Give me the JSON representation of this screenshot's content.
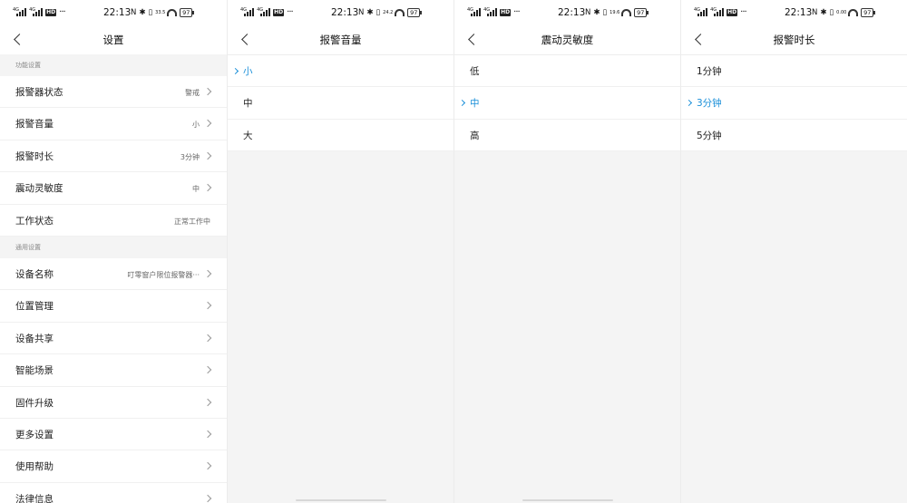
{
  "status": {
    "carrier_a": "4G",
    "carrier_b": "4G",
    "hd": "HD",
    "more": "···",
    "time": "22:13",
    "nfc": "N",
    "speeds": [
      "33.5",
      "24.2",
      "19.6",
      "0.00"
    ],
    "battery": "97"
  },
  "settings": {
    "title": "设置",
    "section_function": "功能设置",
    "function_items": [
      {
        "label": "报警器状态",
        "value": "警戒"
      },
      {
        "label": "报警音量",
        "value": "小"
      },
      {
        "label": "报警时长",
        "value": "3分钟"
      },
      {
        "label": "震动灵敏度",
        "value": "中"
      },
      {
        "label": "工作状态",
        "value": "正常工作中"
      }
    ],
    "section_general": "通用设置",
    "general_items": [
      {
        "label": "设备名称",
        "value": "叮零窗户限位报警器···"
      },
      {
        "label": "位置管理",
        "value": ""
      },
      {
        "label": "设备共享",
        "value": ""
      },
      {
        "label": "智能场景",
        "value": ""
      },
      {
        "label": "固件升级",
        "value": ""
      },
      {
        "label": "更多设置",
        "value": ""
      },
      {
        "label": "使用帮助",
        "value": ""
      },
      {
        "label": "法律信息",
        "value": ""
      }
    ]
  },
  "volume": {
    "title": "报警音量",
    "options": [
      "小",
      "中",
      "大"
    ],
    "selected": "小"
  },
  "sensitivity": {
    "title": "震动灵敏度",
    "options": [
      "低",
      "中",
      "高"
    ],
    "selected": "中"
  },
  "duration": {
    "title": "报警时长",
    "options": [
      "1分钟",
      "3分钟",
      "5分钟"
    ],
    "selected": "3分钟"
  },
  "colors": {
    "accent": "#1a8fd9",
    "background": "#f4f4f4",
    "surface": "#ffffff"
  }
}
